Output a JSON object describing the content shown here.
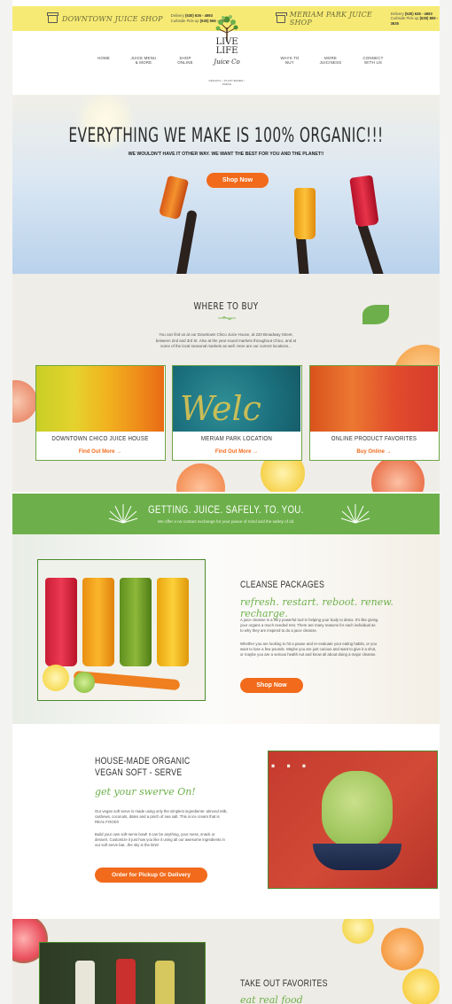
{
  "topbar": {
    "left_shop": {
      "name": "DOWNTOWN JUICE SHOP",
      "delivery_label": "Delivery",
      "delivery_phone": "(530) 636 - 4693",
      "pickup_label": "Curbside Pick-up",
      "pickup_phone": "(530) 566 - 3365"
    },
    "right_shop": {
      "name": "MERIAM PARK JUICE SHOP",
      "delivery_label": "Delivery",
      "delivery_phone": "(530) 636 - 4693",
      "pickup_label": "Curbside Pick-up",
      "pickup_phone": "(530) 809 - 3635"
    }
  },
  "nav": {
    "home": "HOME",
    "menu": "JUICE MENU & MORE",
    "shop": "SHOP ONLINE",
    "ways": "WAYS TO BUY",
    "more": "MORE JUICINESS",
    "connect": "CONNECT WITH US"
  },
  "logo": {
    "line1": "LIVE LIFE",
    "line2": "Juice Co",
    "tagline": "ORGANIC • PLANT-BASED • FRESH"
  },
  "hero": {
    "title": "EVERYTHING WE MAKE IS 100% ORGANIC!!!",
    "subtitle": "WE WOULDN'T HAVE IT OTHER WAY. WE WANT THE BEST FOR YOU AND THE PLANET!!",
    "button": "Shop Now"
  },
  "where": {
    "title": "WHERE TO BUY",
    "text": "You can find us at our Downtown Chico Juice House, at 220 Broadway Street, between 2nd and 3rd St. Also at the year-round markets throughout Chico, and at some of the local seasonal markets as well. Here are our current locations...",
    "cards": [
      {
        "title": "DOWNTOWN CHICO JUICE HOUSE",
        "link": "Find Out More"
      },
      {
        "title": "MERIAM PARK LOCATION",
        "link": "Find Out More"
      },
      {
        "title": "ONLINE PRODUCT FAVORITES",
        "link": "Buy Online"
      }
    ],
    "arrow": "→"
  },
  "band": {
    "title": "GETTING. JUICE. SAFELY. TO. YOU.",
    "text": "We offer a no-contact exchange for your peace of mind and the safety of all."
  },
  "cleanse": {
    "title": "CLEANSE PACKAGES",
    "script": "refresh. restart. reboot. renew. recharge.",
    "p1": "A juice cleanse is a very powerful tool in helping your body to detox. It's like giving your organs a much needed rest. There are many reasons for each individual as to why they are inspired to do a juice cleanse.",
    "p2": "Whether you are looking to hit a pause and re-evaluate your eating habits, or you want to lose a few pounds. Maybe you are just curious and want to give it a shot, or maybe you are a serious health nut and know all about doing a major cleanse.",
    "button": "Shop Now"
  },
  "soft": {
    "title1": "HOUSE-MADE ORGANIC",
    "title2": "VEGAN SOFT - SERVE",
    "script": "get your swerve On!",
    "p1": "Our vegan soft serve is made using only the simplest ingredients- almond milk, cashews, coconuts, dates and a pinch of sea salt. This is ice cream that is REAL FOOD!!",
    "p2": "Build your own soft-serve bowl! It can be anything, your mess, snack or dessert. Customize it just how you like it using all our awesome ingredients in our soft serve bar...the sky is the limit!",
    "button": "Order for Pickup Or Delivery"
  },
  "takeout": {
    "title": "TAKE OUT FAVORITES",
    "script": "eat real food"
  },
  "colors": {
    "accent": "#f26a1b",
    "green": "#6db04b",
    "topbar": "#f7ea74"
  }
}
